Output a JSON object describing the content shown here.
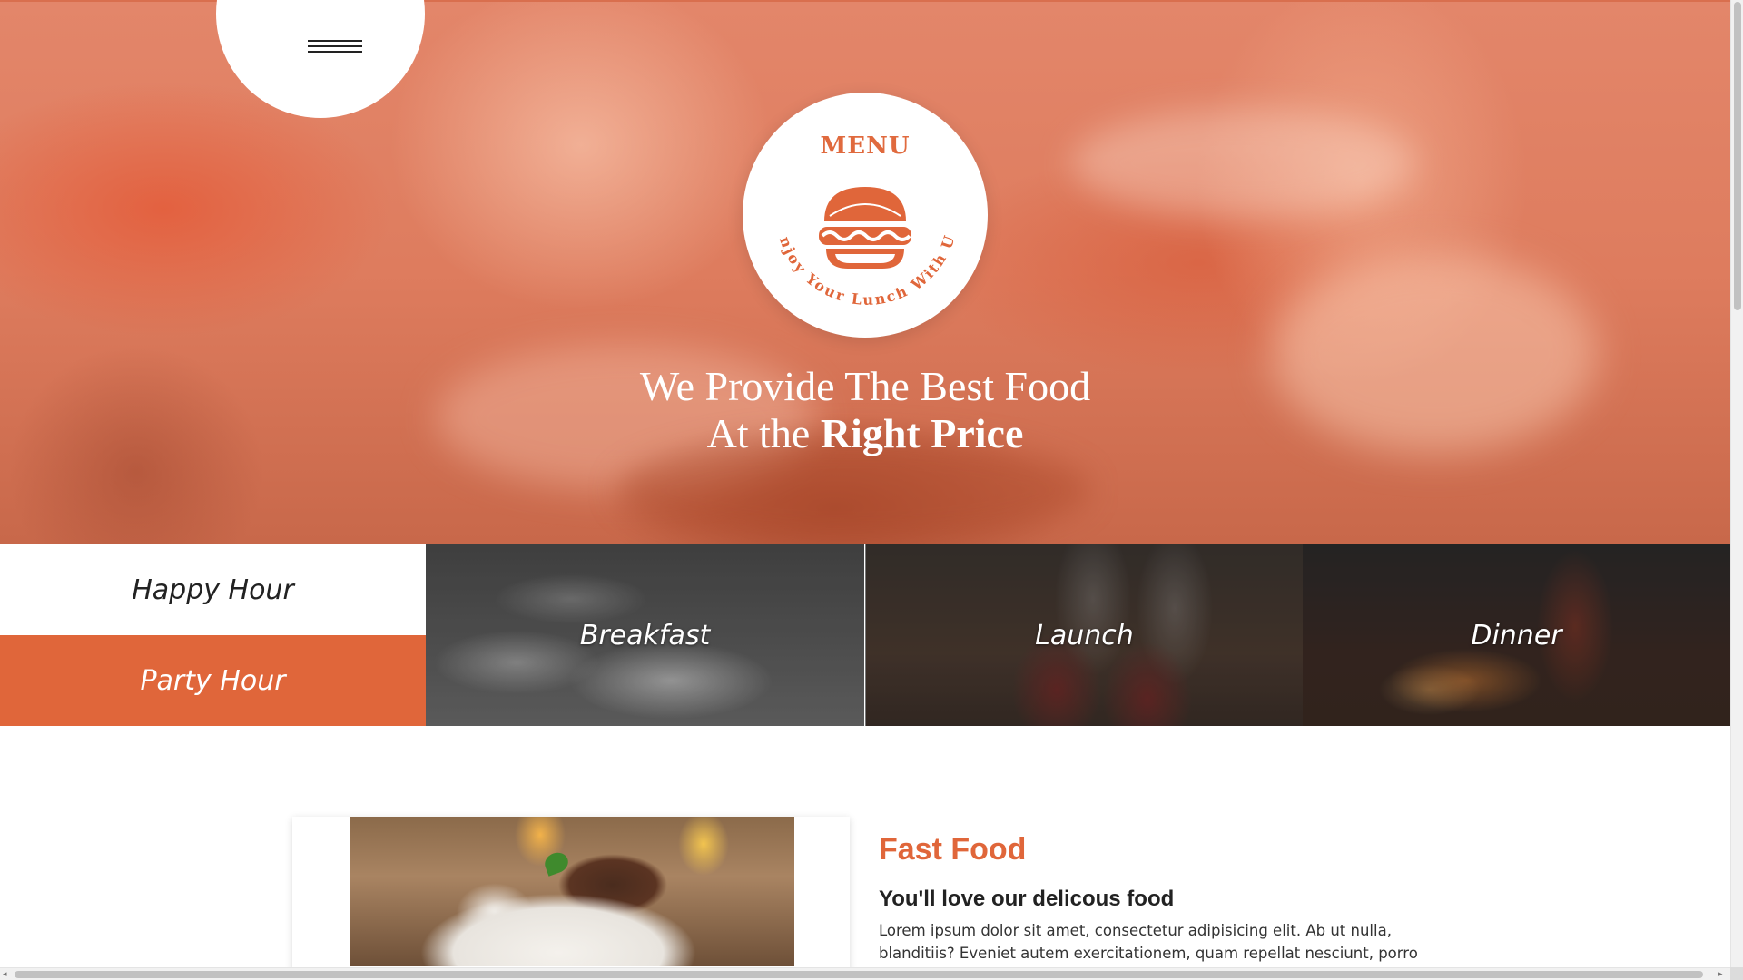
{
  "hero": {
    "logo_title": "MENU",
    "logo_tagline": "Enjoy Your Lunch With Us",
    "heading_line1": "We Provide The Best Food",
    "heading_line2_prefix": "At the ",
    "heading_line2_bold": "Right Price",
    "menu_icon": "hamburger-menu-icon",
    "logo_icon": "burger-icon"
  },
  "band": {
    "happy_hour": "Happy Hour",
    "party_hour": "Party Hour",
    "breakfast": "Breakfast",
    "launch": "Launch",
    "dinner": "Dinner"
  },
  "content": {
    "title": "Fast Food",
    "subtitle": "You'll love our delicous food",
    "body": "Lorem ipsum dolor sit amet, consectetur adipisicing elit. Ab ut nulla, blanditiis? Eveniet autem exercitationem, quam repellat nesciunt, porro facere odit hic"
  },
  "scrollbar": {
    "left_arrow": "◂",
    "right_arrow": "▸"
  },
  "colors": {
    "accent": "#e0663a",
    "hero_overlay": "#e3866a",
    "text_dark": "#222222"
  }
}
